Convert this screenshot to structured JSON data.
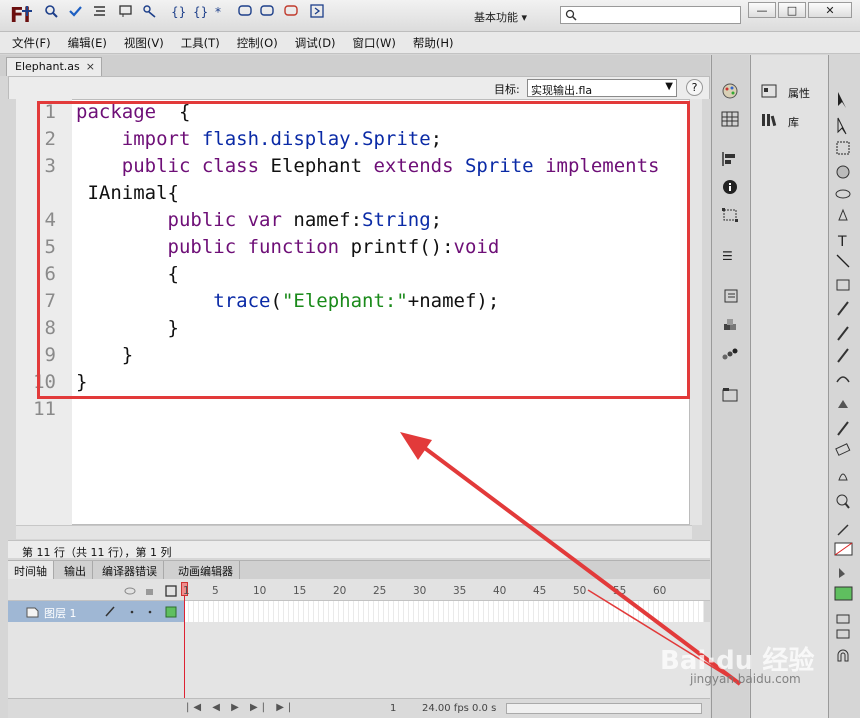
{
  "app": {
    "logo": "Fl",
    "workspace": "基本功能",
    "search_placeholder": "",
    "window_min": "—",
    "window_max": "□",
    "window_close": "✕"
  },
  "menu": [
    "文件(F)",
    "编辑(E)",
    "视图(V)",
    "工具(T)",
    "控制(O)",
    "调试(D)",
    "窗口(W)",
    "帮助(H)"
  ],
  "doc_tab": {
    "label": "Elephant.as",
    "close": "×"
  },
  "toolbar": {
    "target_label": "目标:",
    "target_value": "实现输出.fla",
    "help": "?"
  },
  "line_numbers": [
    "1",
    "2",
    "3",
    "4",
    "5",
    "6",
    "7",
    "8",
    "9",
    "10",
    "11"
  ],
  "status_text": "第 11 行（共 11 行），第 1 列",
  "timeline": {
    "tabs": [
      "时间轴",
      "输出",
      "编译器错误",
      "动画编辑器"
    ],
    "layer_name": "图层 1",
    "frame_numbers": [
      "1",
      "5",
      "10",
      "15",
      "20",
      "25",
      "30",
      "35",
      "40",
      "45",
      "50",
      "55",
      "60"
    ],
    "fps": "24.00 fps",
    "time": "0.0 s",
    "current_frame": "1"
  },
  "panels": {
    "properties": "属性",
    "library": "库"
  },
  "watermark": {
    "main": "Bai·du 经验",
    "sub": "jingyan.baidu.com"
  },
  "colors": {
    "highlight": "#e23a3a",
    "keyword": "#6e0f77",
    "type": "#0a2aa6",
    "string": "#1a8a1a"
  }
}
